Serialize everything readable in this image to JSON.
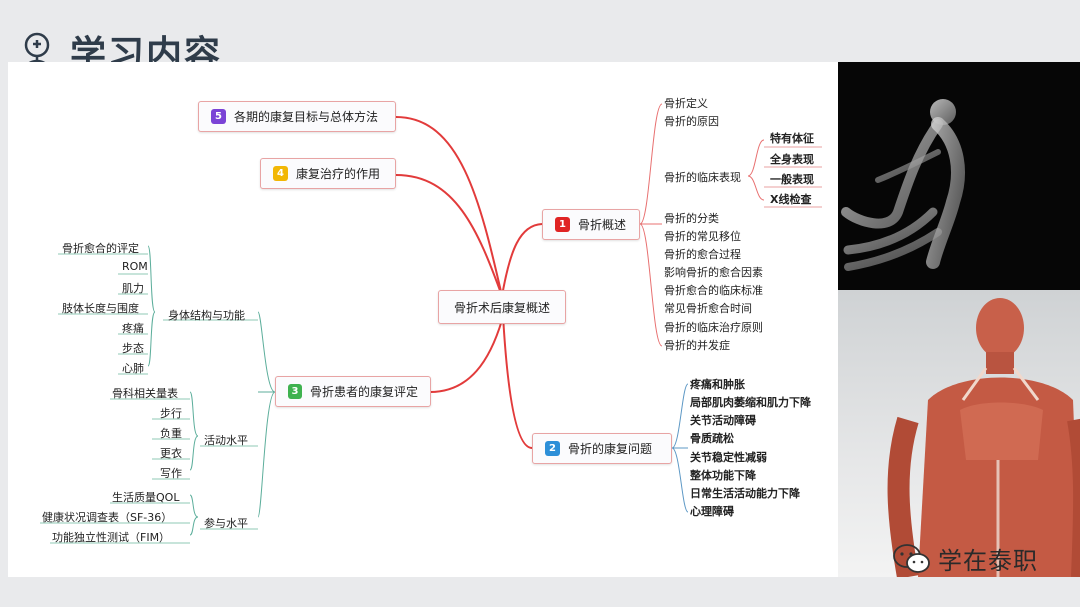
{
  "header": {
    "title": "学习内容"
  },
  "diagram": {
    "center": "骨折术后康复概述",
    "branches": [
      {
        "num": "5",
        "color": "#7b43d6",
        "label": "各期的康复目标与总体方法"
      },
      {
        "num": "4",
        "color": "#f2b705",
        "label": "康复治疗的作用"
      },
      {
        "num": "1",
        "color": "#e02424",
        "label": "骨折概述"
      },
      {
        "num": "2",
        "color": "#2d8fd8",
        "label": "骨折的康复问题"
      },
      {
        "num": "3",
        "color": "#3fb24f",
        "label": "骨折患者的康复评定"
      }
    ],
    "overview_items": [
      "骨折定义",
      "骨折的原因",
      "骨折的临床表现",
      "骨折的分类",
      "骨折的常见移位",
      "骨折的愈合过程",
      "影响骨折的愈合因素",
      "骨折愈合的临床标准",
      "常见骨折愈合时间",
      "骨折的临床治疗原则",
      "骨折的并发症"
    ],
    "clinical_items": [
      "特有体征",
      "全身表现",
      "一般表现",
      "X线检查"
    ],
    "problem_items": [
      "疼痛和肿胀",
      "局部肌肉萎缩和肌力下降",
      "关节活动障碍",
      "骨质疏松",
      "关节稳定性减弱",
      "整体功能下降",
      "日常生活活动能力下降",
      "心理障碍"
    ],
    "assessment_groups": [
      {
        "label": "身体结构与功能",
        "items": [
          "骨折愈合的评定",
          "ROM",
          "肌力",
          "肢体长度与围度",
          "疼痛",
          "步态",
          "心肺"
        ]
      },
      {
        "label": "活动水平",
        "items": [
          "骨科相关量表",
          "步行",
          "负重",
          "更衣",
          "写作"
        ]
      },
      {
        "label": "参与水平",
        "items": [
          "生活质量QOL",
          "健康状况调查表（SF-36）",
          "功能独立性测试（FIM）"
        ]
      }
    ]
  },
  "watermark": {
    "text": "学在泰职"
  }
}
